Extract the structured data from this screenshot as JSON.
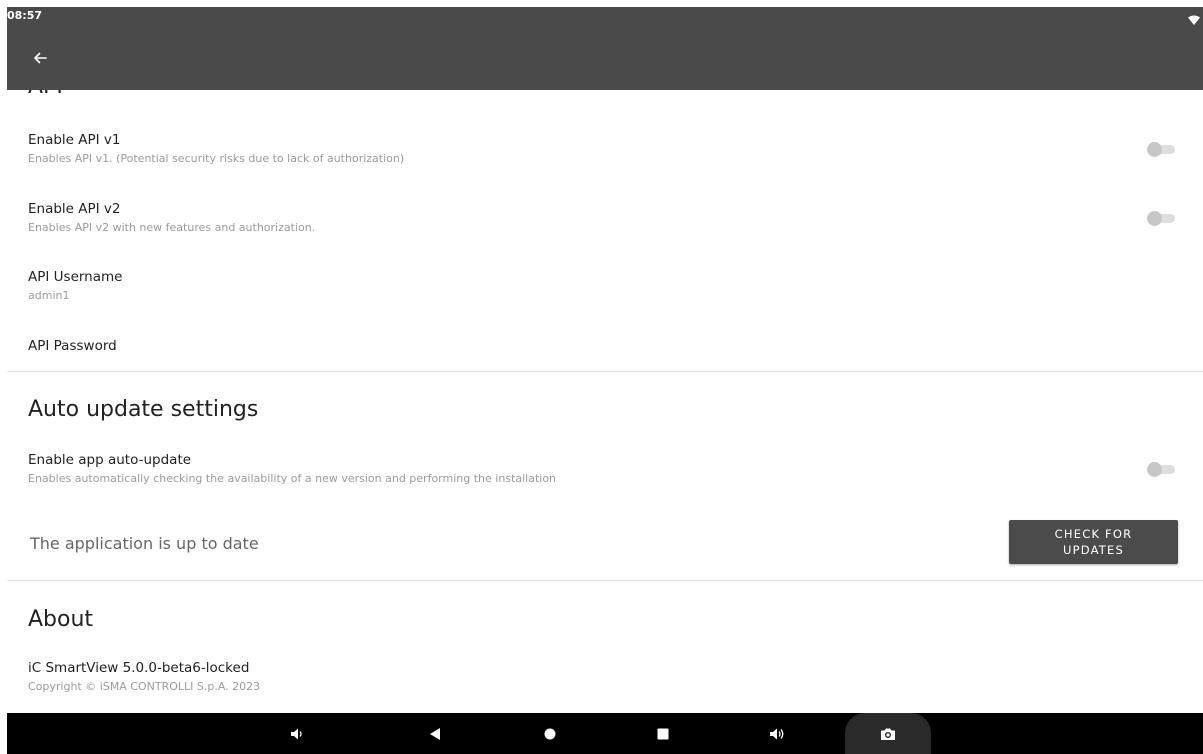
{
  "status_bar": {
    "time": "08:57"
  },
  "app_bar": {
    "back_icon": "arrow-left-icon"
  },
  "sections": {
    "api": {
      "title": "API",
      "enable_v1": {
        "title": "Enable API v1",
        "summary": "Enables API v1. (Potential security risks due to lack of authorization)",
        "enabled": false
      },
      "enable_v2": {
        "title": "Enable API v2",
        "summary": "Enables API v2 with new features and authorization.",
        "enabled": false
      },
      "username": {
        "title": "API Username",
        "value": "admin1"
      },
      "password": {
        "title": "API Password"
      }
    },
    "auto_update": {
      "title": "Auto update settings",
      "enable_auto_update": {
        "title": "Enable app auto-update",
        "summary": "Enables automatically checking the availability of a new version and performing the installation",
        "enabled": false
      },
      "status_text": "The application is up to date",
      "check_button_label": "CHECK FOR\nUPDATES"
    },
    "about": {
      "title": "About",
      "version": "iC SmartView 5.0.0-beta6-locked",
      "copyright": "Copyright © iSMA CONTROLLI S.p.A. 2023"
    }
  },
  "nav_bar": {
    "icons": [
      "volume-down-icon",
      "back-triangle-icon",
      "home-circle-icon",
      "recents-square-icon",
      "volume-up-icon",
      "camera-icon"
    ]
  },
  "colors": {
    "app_bar": "#4a4a4a",
    "button": "#4b4b4b",
    "switch_off": "#c7c7c7"
  }
}
